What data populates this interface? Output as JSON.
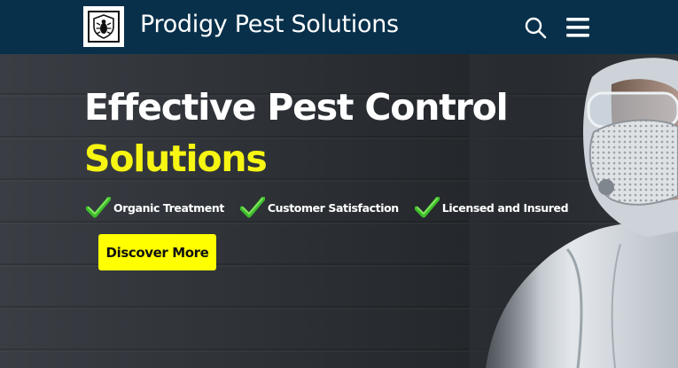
{
  "header": {
    "brand_name": "Prodigy Pest Solutions",
    "logo_icon": "bug-shield-icon",
    "search_icon": "search-icon",
    "menu_icon": "hamburger-menu-icon",
    "background_color": "#08304b"
  },
  "hero": {
    "headline_line1": "Effective Pest Control",
    "headline_line2": "Solutions",
    "accent_color": "#f7f512",
    "features": [
      {
        "label": "Organic Treatment",
        "icon": "checkmark-icon"
      },
      {
        "label": "Customer Satisfaction",
        "icon": "checkmark-icon"
      },
      {
        "label": "Licensed and Insured",
        "icon": "checkmark-icon"
      }
    ],
    "cta_label": "Discover More",
    "cta_color": "#ffff00",
    "background_image": "pest-control-technician-photo"
  }
}
